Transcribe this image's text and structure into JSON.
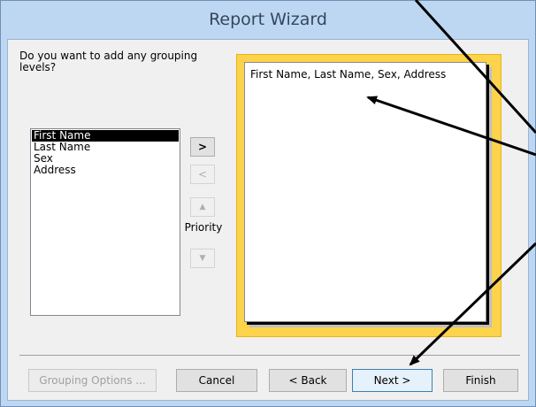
{
  "window": {
    "title": "Report Wizard"
  },
  "wizard": {
    "question": "Do you want to add any grouping levels?",
    "fields": [
      {
        "label": "First Name",
        "selected": true
      },
      {
        "label": "Last Name",
        "selected": false
      },
      {
        "label": "Sex",
        "selected": false
      },
      {
        "label": "Address",
        "selected": false
      }
    ],
    "add_label": ">",
    "remove_label": "<",
    "priority_up_label": "▲",
    "priority_down_label": "▼",
    "priority_label": "Priority",
    "preview_text": "First Name, Last Name, Sex, Address"
  },
  "buttons": {
    "grouping_options": "Grouping Options ...",
    "cancel": "Cancel",
    "back": "< Back",
    "next": "Next >",
    "finish": "Finish"
  },
  "colors": {
    "titlebar": "#bdd7f2",
    "preview_frame": "#fcd34a",
    "selection": "#000000",
    "arrow": "#000000"
  }
}
